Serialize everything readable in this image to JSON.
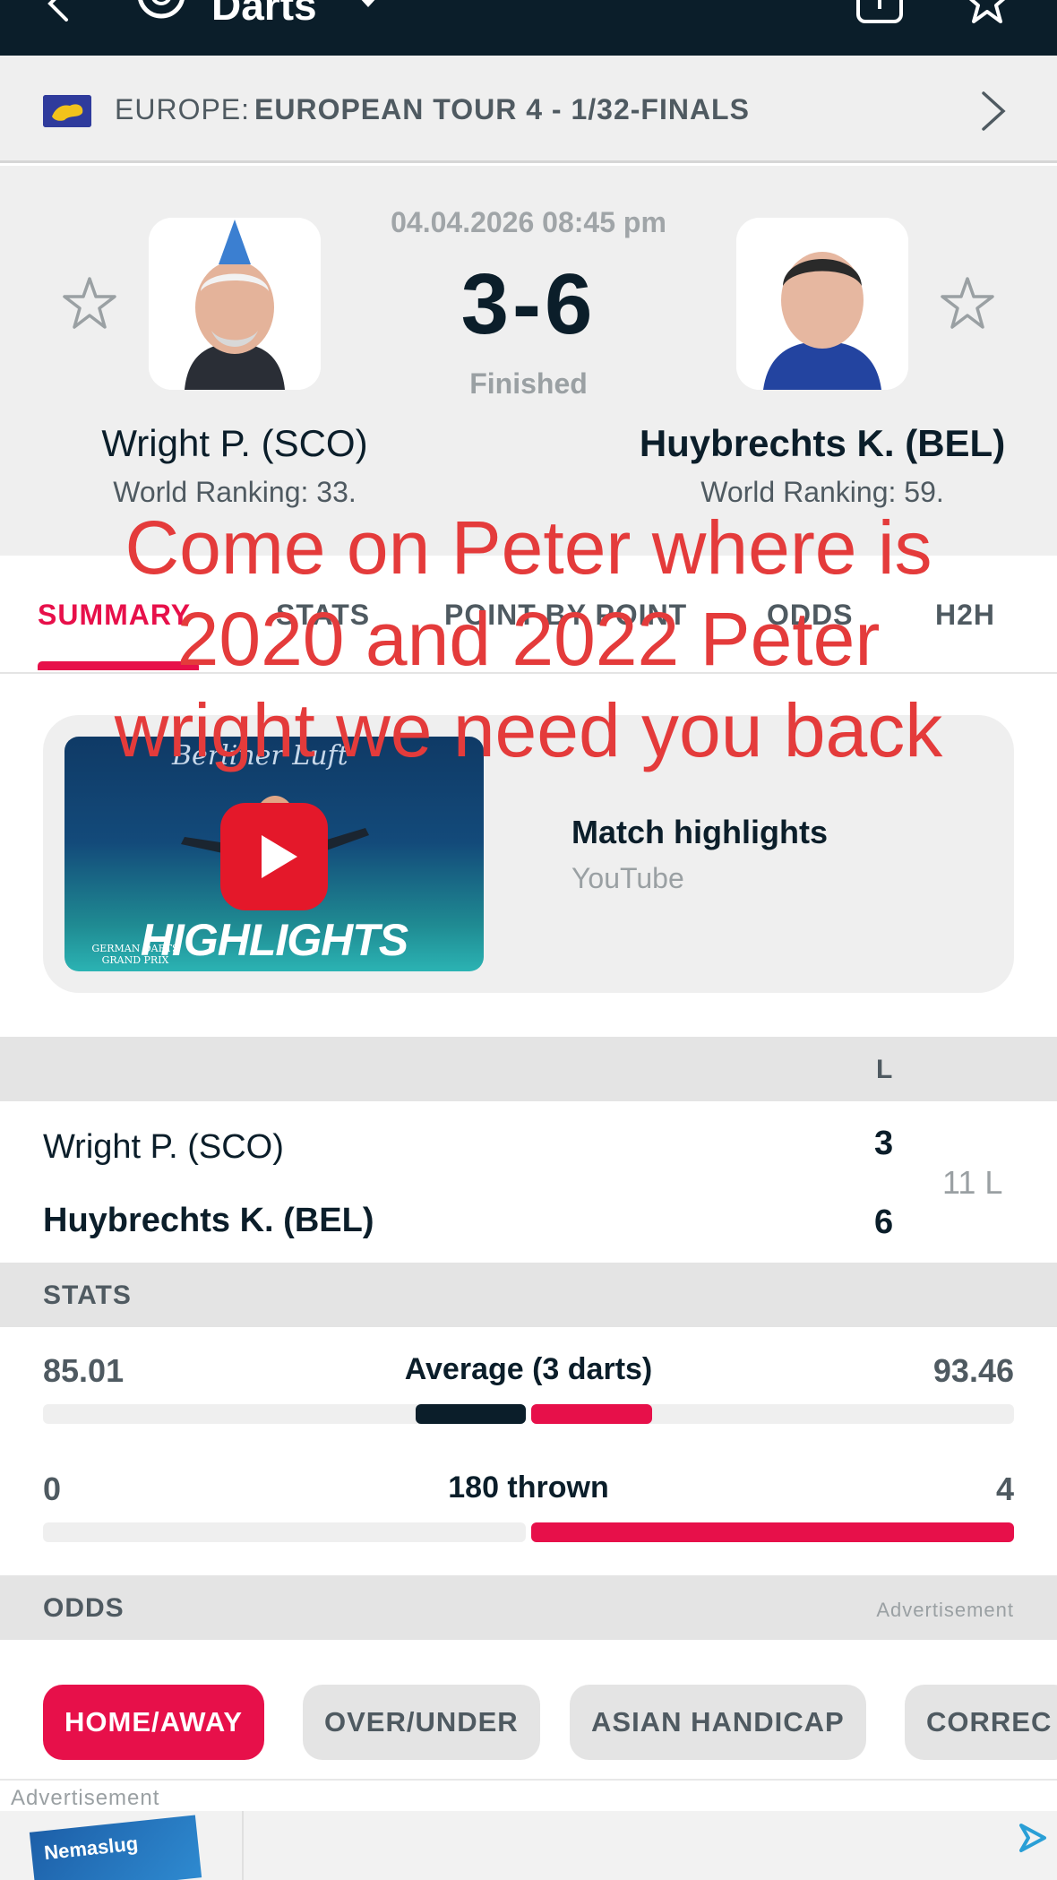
{
  "app": {
    "sport_title": "Darts"
  },
  "league": {
    "prefix": "EUROPE:",
    "name": "EUROPEAN TOUR 4 - 1/32-FINALS"
  },
  "match": {
    "datetime": "04.04.2026 08:45 pm",
    "score": "3-6",
    "status": "Finished",
    "home": {
      "name": "Wright P. (SCO)",
      "ranking": "World Ranking: 33."
    },
    "away": {
      "name": "Huybrechts K. (BEL)",
      "ranking": "World Ranking: 59."
    }
  },
  "tabs": [
    {
      "label": "SUMMARY",
      "active": true
    },
    {
      "label": "STATS"
    },
    {
      "label": "POINT BY POINT"
    },
    {
      "label": "ODDS"
    },
    {
      "label": "H2H"
    }
  ],
  "highlights": {
    "title": "Match highlights",
    "source": "YouTube",
    "thumb_text": "HIGHLIGHTS",
    "thumb_brand": "Berliner Luft",
    "thumb_event": "GERMAN DARTS GRAND PRIX"
  },
  "result_table": {
    "column": "L",
    "rows": [
      {
        "name": "Wright P. (SCO)",
        "score": "3"
      },
      {
        "name": "Huybrechts K. (BEL)",
        "score": "6"
      }
    ],
    "legs_note": "11 L"
  },
  "stats": {
    "header": "STATS",
    "items": [
      {
        "label": "Average (3 darts)",
        "home": "85.01",
        "away": "93.46",
        "home_share": 0.4763,
        "away_share": 0.5237
      },
      {
        "label": "180 thrown",
        "home": "0",
        "away": "4",
        "home_share": 0.0,
        "away_share": 1.0
      }
    ]
  },
  "odds": {
    "header": "ODDS",
    "ad_label": "Advertisement",
    "pills": [
      "HOME/AWAY",
      "OVER/UNDER",
      "ASIAN HANDICAP",
      "CORREC"
    ]
  },
  "ad": {
    "label": "Advertisement",
    "product": "Nemaslug"
  },
  "overlay": {
    "lines": [
      "Come on Peter where is",
      "2020 and 2022 Peter",
      "wright we need you back"
    ]
  },
  "colors": {
    "accent": "#e7104a",
    "dark": "#0b1e2a",
    "overlay": "#e43b3b"
  }
}
